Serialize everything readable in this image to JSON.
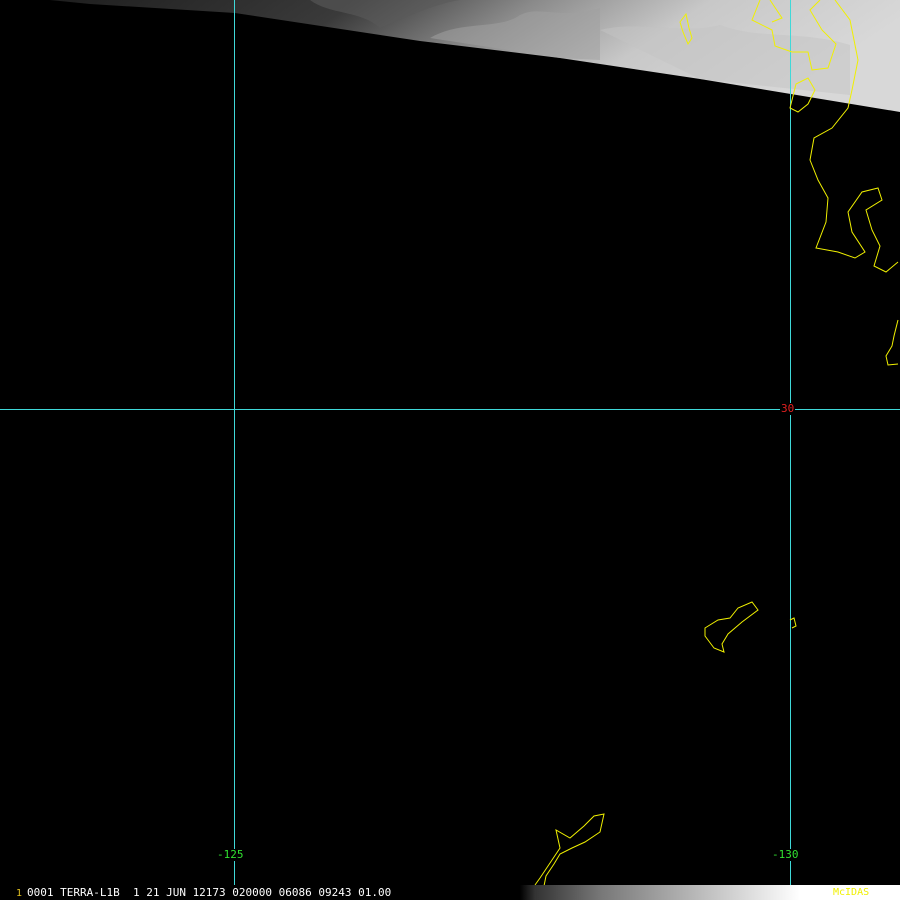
{
  "colors": {
    "background": "#000000",
    "grid_line": "#3fd8d8",
    "coastline": "#f0f000",
    "latitude_label": "#e02020",
    "longitude_label": "#30e030",
    "status_text": "#ffffff",
    "frame_number": "#e0c020",
    "logo": "#f0f000"
  },
  "grid": {
    "latitude_labels": [
      "30"
    ],
    "longitude_labels": [
      "-125",
      "-130"
    ]
  },
  "status_bar": {
    "frame_number": "1",
    "text": "0001 TERRA-L1B  1 21 JUN 12173 020000 06086 09243 01.00",
    "logo": "McIDAS"
  },
  "icons": {
    "cloud_imagery": "grayscale-cloud-swath",
    "coastline": "coastline-outline"
  }
}
